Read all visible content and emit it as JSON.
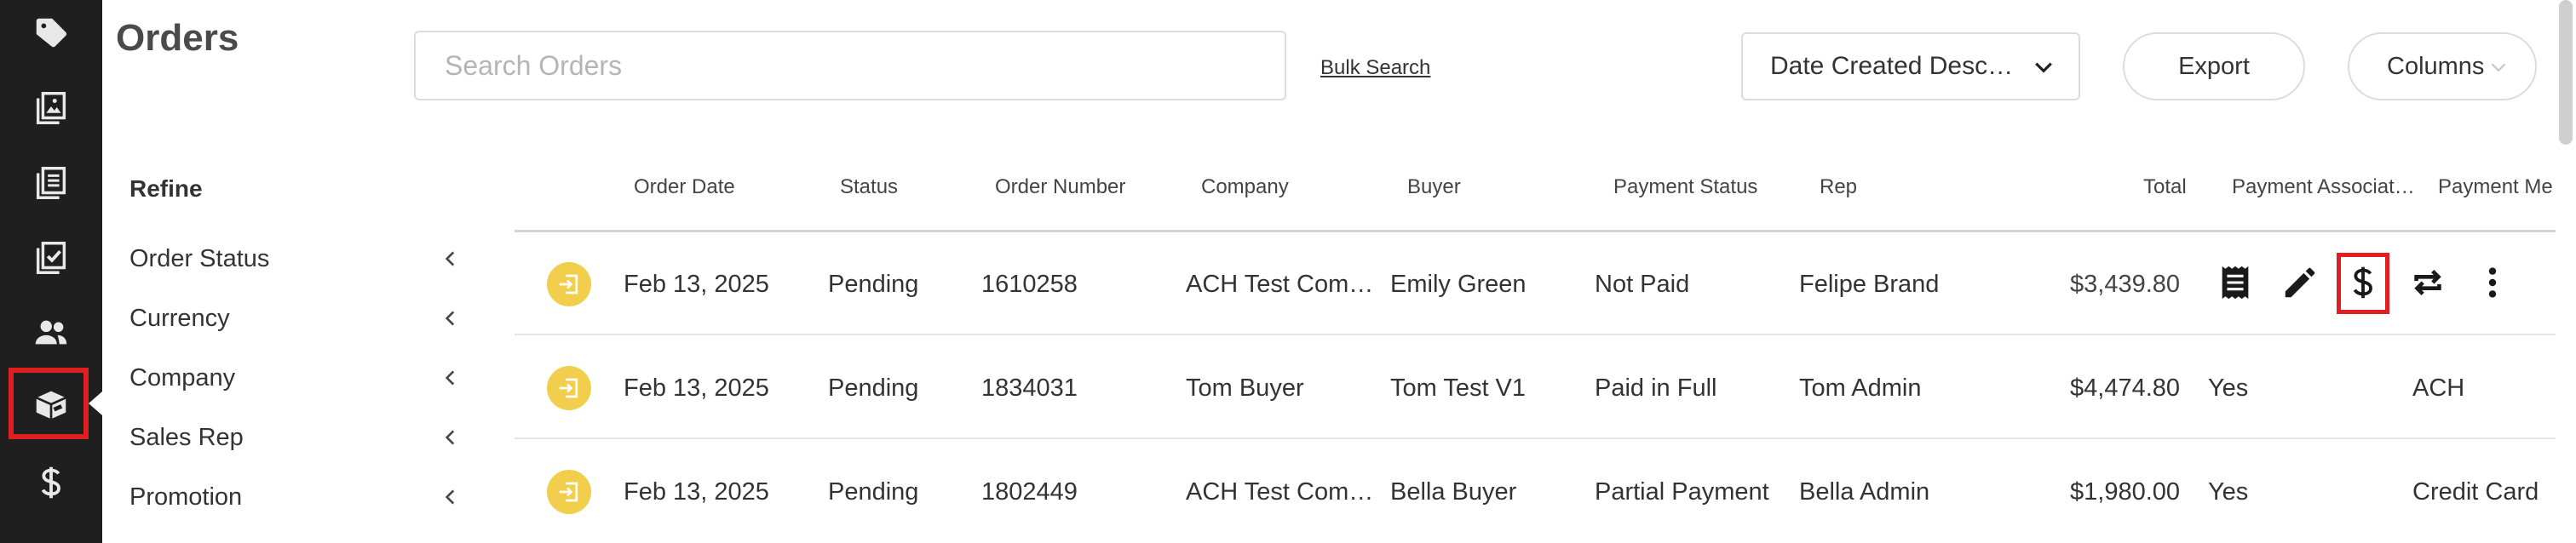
{
  "page": {
    "title": "Orders"
  },
  "rail": {
    "items": [
      {
        "name": "tag-icon"
      },
      {
        "name": "catalog-icon"
      },
      {
        "name": "list-icon"
      },
      {
        "name": "checklist-icon"
      },
      {
        "name": "users-icon"
      },
      {
        "name": "orders-box-icon",
        "active": true
      },
      {
        "name": "dollar-icon"
      }
    ],
    "highlight_color": "#e02020"
  },
  "toolbar": {
    "search_placeholder": "Search Orders",
    "bulk_search": "Bulk Search",
    "sort_value": "Date Created Desc…",
    "export_label": "Export",
    "columns_label": "Columns"
  },
  "refine": {
    "title": "Refine",
    "items": [
      {
        "label": "Order Status"
      },
      {
        "label": "Currency"
      },
      {
        "label": "Company"
      },
      {
        "label": "Sales Rep"
      },
      {
        "label": "Promotion"
      }
    ]
  },
  "table": {
    "headers": {
      "order_date": "Order Date",
      "status": "Status",
      "order_number": "Order Number",
      "company": "Company",
      "buyer": "Buyer",
      "payment_status": "Payment Status",
      "rep": "Rep",
      "total": "Total",
      "payment_associated": "Payment Associat…",
      "payment_method": "Payment Me"
    },
    "rows": [
      {
        "order_date": "Feb 13, 2025",
        "status": "Pending",
        "order_number": "1610258",
        "company": "ACH Test Com…",
        "buyer": "Emily Green",
        "payment_status": "Not Paid",
        "rep": "Felipe Brand",
        "total": "$3,439.80",
        "payment_associated": "",
        "payment_method": "",
        "hovered": true
      },
      {
        "order_date": "Feb 13, 2025",
        "status": "Pending",
        "order_number": "1834031",
        "company": "Tom Buyer",
        "buyer": "Tom Test V1",
        "payment_status": "Paid in Full",
        "rep": "Tom Admin",
        "total": "$4,474.80",
        "payment_associated": "Yes",
        "payment_method": "ACH"
      },
      {
        "order_date": "Feb 13, 2025",
        "status": "Pending",
        "order_number": "1802449",
        "company": "ACH Test Com…",
        "buyer": "Bella Buyer",
        "payment_status": "Partial Payment",
        "rep": "Bella Admin",
        "total": "$1,980.00",
        "payment_associated": "Yes",
        "payment_method": "Credit Card"
      }
    ],
    "row_actions": [
      "receipt-icon",
      "edit-icon",
      "dollar-icon",
      "refresh-icon",
      "more-icon"
    ]
  },
  "colors": {
    "rail_bg": "#1f1f1f",
    "row_icon_bg": "#f1cf4d",
    "highlight": "#e02020"
  }
}
